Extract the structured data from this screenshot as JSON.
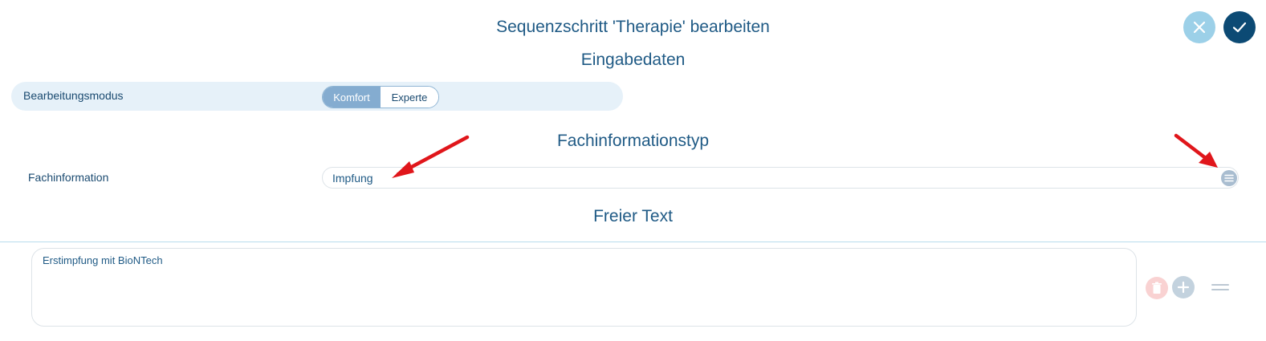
{
  "header": {
    "title": "Sequenzschritt 'Therapie' bearbeiten",
    "cancel_icon": "close-icon",
    "confirm_icon": "check-icon"
  },
  "sections": {
    "input_data": "Eingabedaten",
    "info_type": "Fachinformationstyp",
    "free_text": "Freier Text"
  },
  "mode": {
    "label": "Bearbeitungsmodus",
    "options": [
      "Komfort",
      "Experte"
    ],
    "selected": "Komfort"
  },
  "fachinformation": {
    "label": "Fachinformation",
    "value": "Impfung",
    "menu_icon": "list-icon"
  },
  "free_text": {
    "value": "Erstimpfung mit BioNTech",
    "delete_icon": "trash-icon",
    "add_icon": "plus-icon",
    "drag_icon": "drag-handle-icon"
  },
  "colors": {
    "primary": "#1f5a85",
    "confirm": "#0c4a74",
    "cancel": "#9cd0e8",
    "annotation_arrow": "#e0161b"
  }
}
